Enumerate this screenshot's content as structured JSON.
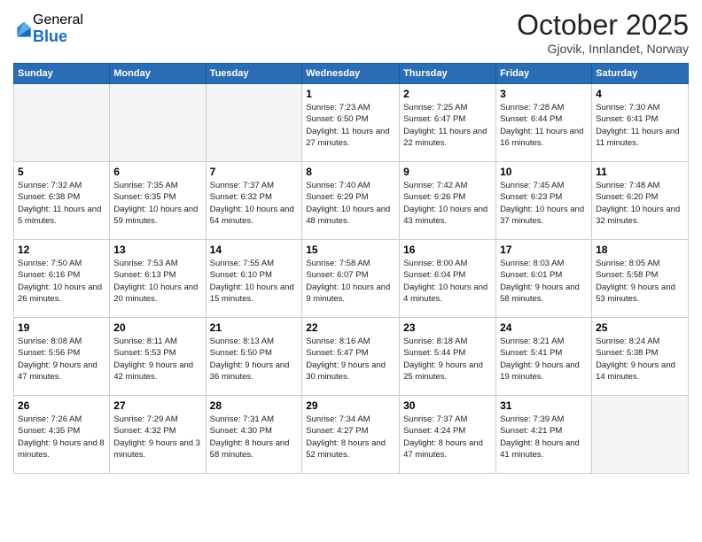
{
  "header": {
    "logo_general": "General",
    "logo_blue": "Blue",
    "month_title": "October 2025",
    "location": "Gjovik, Innlandet, Norway"
  },
  "weekdays": [
    "Sunday",
    "Monday",
    "Tuesday",
    "Wednesday",
    "Thursday",
    "Friday",
    "Saturday"
  ],
  "weeks": [
    [
      {
        "day": "",
        "info": ""
      },
      {
        "day": "",
        "info": ""
      },
      {
        "day": "",
        "info": ""
      },
      {
        "day": "1",
        "info": "Sunrise: 7:23 AM\nSunset: 6:50 PM\nDaylight: 11 hours\nand 27 minutes."
      },
      {
        "day": "2",
        "info": "Sunrise: 7:25 AM\nSunset: 6:47 PM\nDaylight: 11 hours\nand 22 minutes."
      },
      {
        "day": "3",
        "info": "Sunrise: 7:28 AM\nSunset: 6:44 PM\nDaylight: 11 hours\nand 16 minutes."
      },
      {
        "day": "4",
        "info": "Sunrise: 7:30 AM\nSunset: 6:41 PM\nDaylight: 11 hours\nand 11 minutes."
      }
    ],
    [
      {
        "day": "5",
        "info": "Sunrise: 7:32 AM\nSunset: 6:38 PM\nDaylight: 11 hours\nand 5 minutes."
      },
      {
        "day": "6",
        "info": "Sunrise: 7:35 AM\nSunset: 6:35 PM\nDaylight: 10 hours\nand 59 minutes."
      },
      {
        "day": "7",
        "info": "Sunrise: 7:37 AM\nSunset: 6:32 PM\nDaylight: 10 hours\nand 54 minutes."
      },
      {
        "day": "8",
        "info": "Sunrise: 7:40 AM\nSunset: 6:29 PM\nDaylight: 10 hours\nand 48 minutes."
      },
      {
        "day": "9",
        "info": "Sunrise: 7:42 AM\nSunset: 6:26 PM\nDaylight: 10 hours\nand 43 minutes."
      },
      {
        "day": "10",
        "info": "Sunrise: 7:45 AM\nSunset: 6:23 PM\nDaylight: 10 hours\nand 37 minutes."
      },
      {
        "day": "11",
        "info": "Sunrise: 7:48 AM\nSunset: 6:20 PM\nDaylight: 10 hours\nand 32 minutes."
      }
    ],
    [
      {
        "day": "12",
        "info": "Sunrise: 7:50 AM\nSunset: 6:16 PM\nDaylight: 10 hours\nand 26 minutes."
      },
      {
        "day": "13",
        "info": "Sunrise: 7:53 AM\nSunset: 6:13 PM\nDaylight: 10 hours\nand 20 minutes."
      },
      {
        "day": "14",
        "info": "Sunrise: 7:55 AM\nSunset: 6:10 PM\nDaylight: 10 hours\nand 15 minutes."
      },
      {
        "day": "15",
        "info": "Sunrise: 7:58 AM\nSunset: 6:07 PM\nDaylight: 10 hours\nand 9 minutes."
      },
      {
        "day": "16",
        "info": "Sunrise: 8:00 AM\nSunset: 6:04 PM\nDaylight: 10 hours\nand 4 minutes."
      },
      {
        "day": "17",
        "info": "Sunrise: 8:03 AM\nSunset: 6:01 PM\nDaylight: 9 hours\nand 58 minutes."
      },
      {
        "day": "18",
        "info": "Sunrise: 8:05 AM\nSunset: 5:58 PM\nDaylight: 9 hours\nand 53 minutes."
      }
    ],
    [
      {
        "day": "19",
        "info": "Sunrise: 8:08 AM\nSunset: 5:56 PM\nDaylight: 9 hours\nand 47 minutes."
      },
      {
        "day": "20",
        "info": "Sunrise: 8:11 AM\nSunset: 5:53 PM\nDaylight: 9 hours\nand 42 minutes."
      },
      {
        "day": "21",
        "info": "Sunrise: 8:13 AM\nSunset: 5:50 PM\nDaylight: 9 hours\nand 36 minutes."
      },
      {
        "day": "22",
        "info": "Sunrise: 8:16 AM\nSunset: 5:47 PM\nDaylight: 9 hours\nand 30 minutes."
      },
      {
        "day": "23",
        "info": "Sunrise: 8:18 AM\nSunset: 5:44 PM\nDaylight: 9 hours\nand 25 minutes."
      },
      {
        "day": "24",
        "info": "Sunrise: 8:21 AM\nSunset: 5:41 PM\nDaylight: 9 hours\nand 19 minutes."
      },
      {
        "day": "25",
        "info": "Sunrise: 8:24 AM\nSunset: 5:38 PM\nDaylight: 9 hours\nand 14 minutes."
      }
    ],
    [
      {
        "day": "26",
        "info": "Sunrise: 7:26 AM\nSunset: 4:35 PM\nDaylight: 9 hours\nand 8 minutes."
      },
      {
        "day": "27",
        "info": "Sunrise: 7:29 AM\nSunset: 4:32 PM\nDaylight: 9 hours\nand 3 minutes."
      },
      {
        "day": "28",
        "info": "Sunrise: 7:31 AM\nSunset: 4:30 PM\nDaylight: 8 hours\nand 58 minutes."
      },
      {
        "day": "29",
        "info": "Sunrise: 7:34 AM\nSunset: 4:27 PM\nDaylight: 8 hours\nand 52 minutes."
      },
      {
        "day": "30",
        "info": "Sunrise: 7:37 AM\nSunset: 4:24 PM\nDaylight: 8 hours\nand 47 minutes."
      },
      {
        "day": "31",
        "info": "Sunrise: 7:39 AM\nSunset: 4:21 PM\nDaylight: 8 hours\nand 41 minutes."
      },
      {
        "day": "",
        "info": ""
      }
    ]
  ]
}
